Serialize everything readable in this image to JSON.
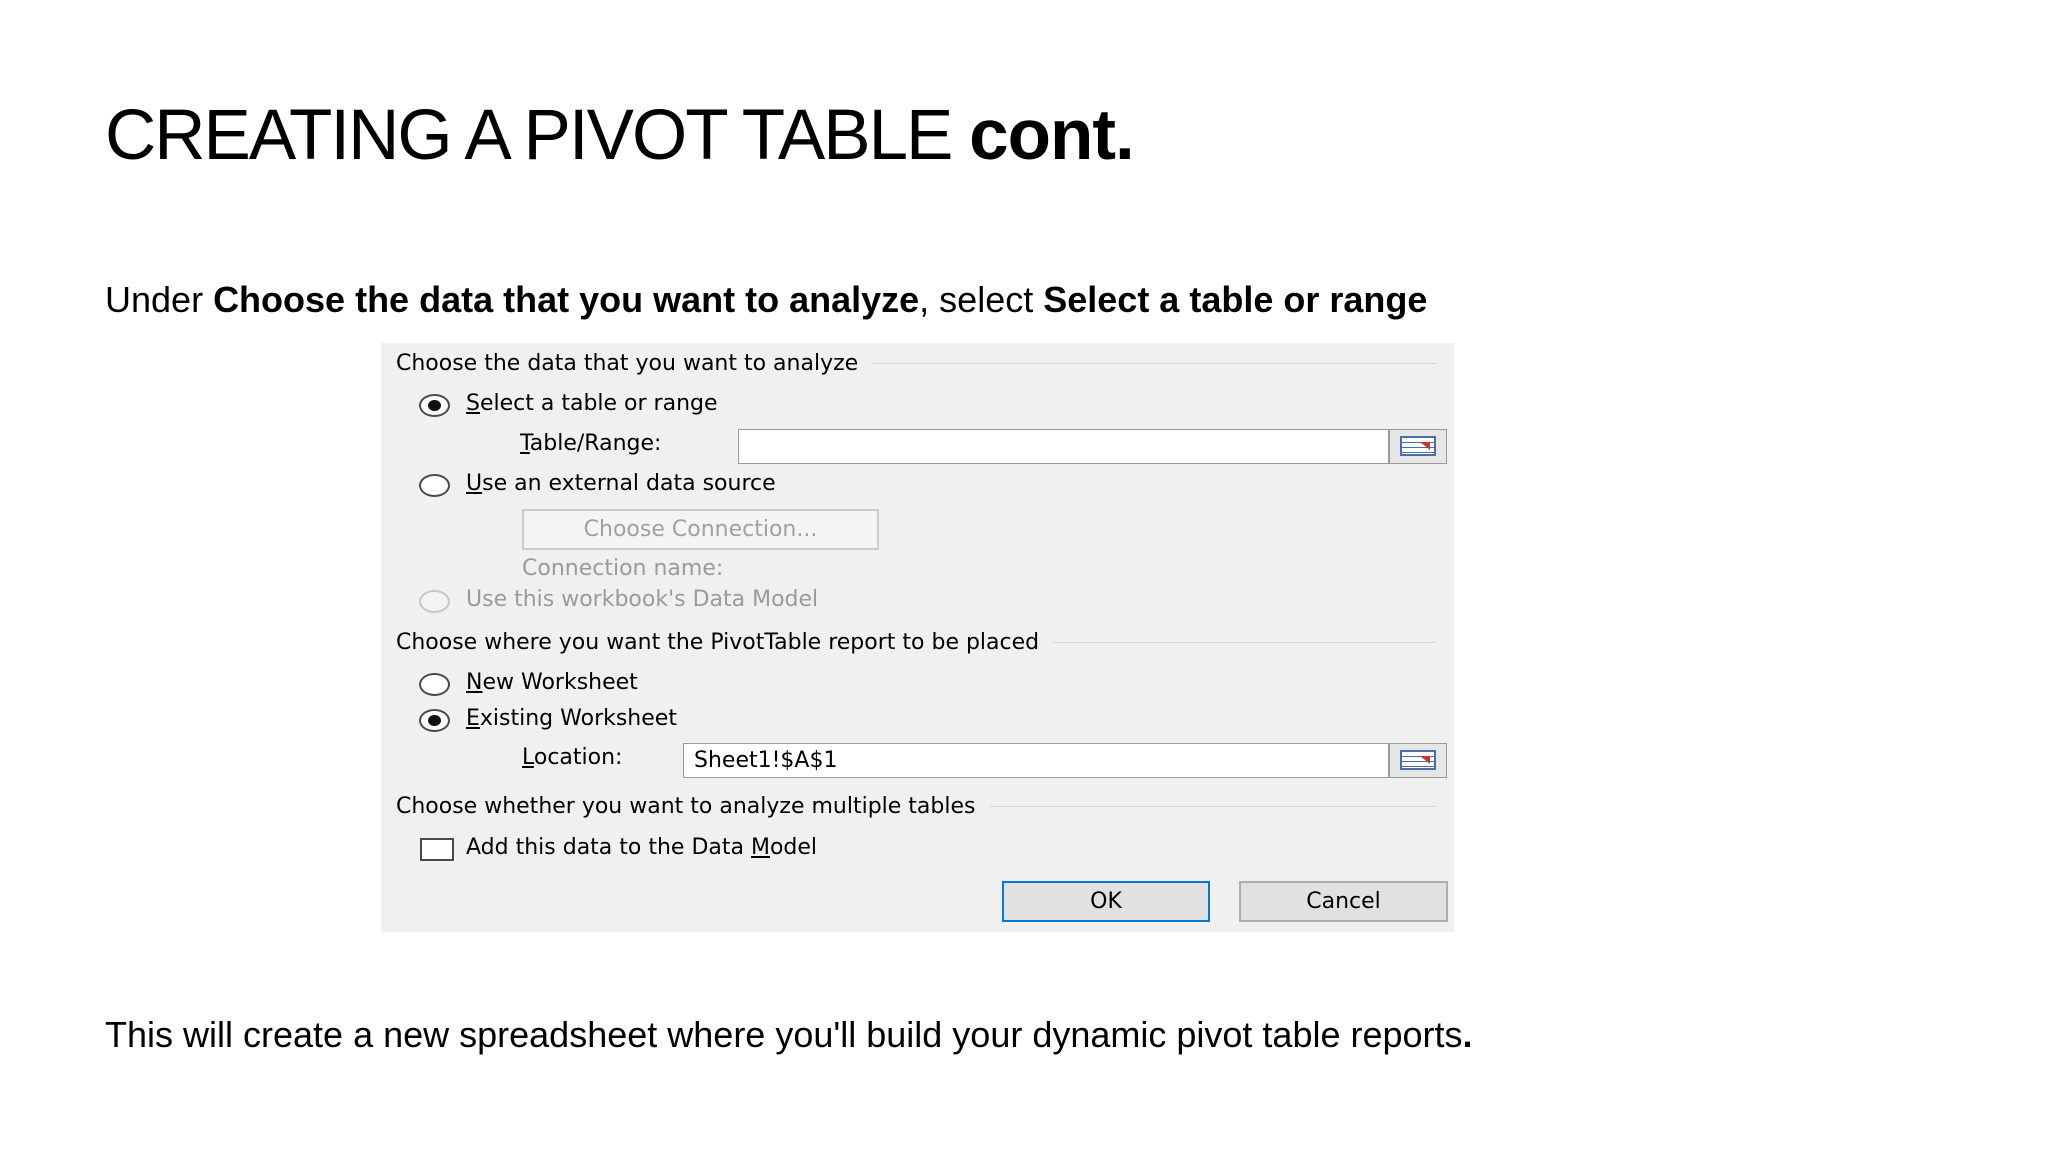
{
  "slide": {
    "title_main": "CREATING A PIVOT TABLE",
    "title_suffix": "cont.",
    "instruction": {
      "prefix": "Under ",
      "bold1": "Choose the data that you want to analyze",
      "middle": ", select ",
      "bold2": "Select a table or range"
    },
    "footer": {
      "text": "This will create a new spreadsheet where you'll build your dynamic pivot table reports",
      "end": "."
    }
  },
  "dialog": {
    "section_data_label": "Choose the data that you want to analyze",
    "select_table": {
      "hotkey": "S",
      "rest": "elect a table or range",
      "checked": true
    },
    "table_range": {
      "hotkey": "T",
      "rest": "able/Range:",
      "value": ""
    },
    "external_source": {
      "hotkey": "U",
      "rest": "se an external data source",
      "checked": false
    },
    "choose_connection_label": "Choose Connection...",
    "connection_name_label": "Connection name:",
    "data_model_option": {
      "label": "Use this workbook's Data Model",
      "enabled": false
    },
    "section_place_label": "Choose where you want the PivotTable report to be placed",
    "new_worksheet": {
      "hotkey": "N",
      "rest": "ew Worksheet",
      "checked": false
    },
    "existing_worksheet": {
      "hotkey": "E",
      "rest": "xisting Worksheet",
      "checked": true
    },
    "location": {
      "hotkey": "L",
      "rest": "ocation:",
      "value": "Sheet1!$A$1"
    },
    "section_multi_label": "Choose whether you want to analyze multiple tables",
    "add_to_model": {
      "before": "Add this data to the Data ",
      "hotkey": "M",
      "after": "odel",
      "checked": false
    },
    "ok_label": "OK",
    "cancel_label": "Cancel",
    "icons": {
      "range_picker": "range-picker-icon"
    },
    "colors": {
      "background": "#f0f0f0",
      "default_button_border": "#0078d7",
      "disabled_text": "#9a9a9a"
    }
  }
}
